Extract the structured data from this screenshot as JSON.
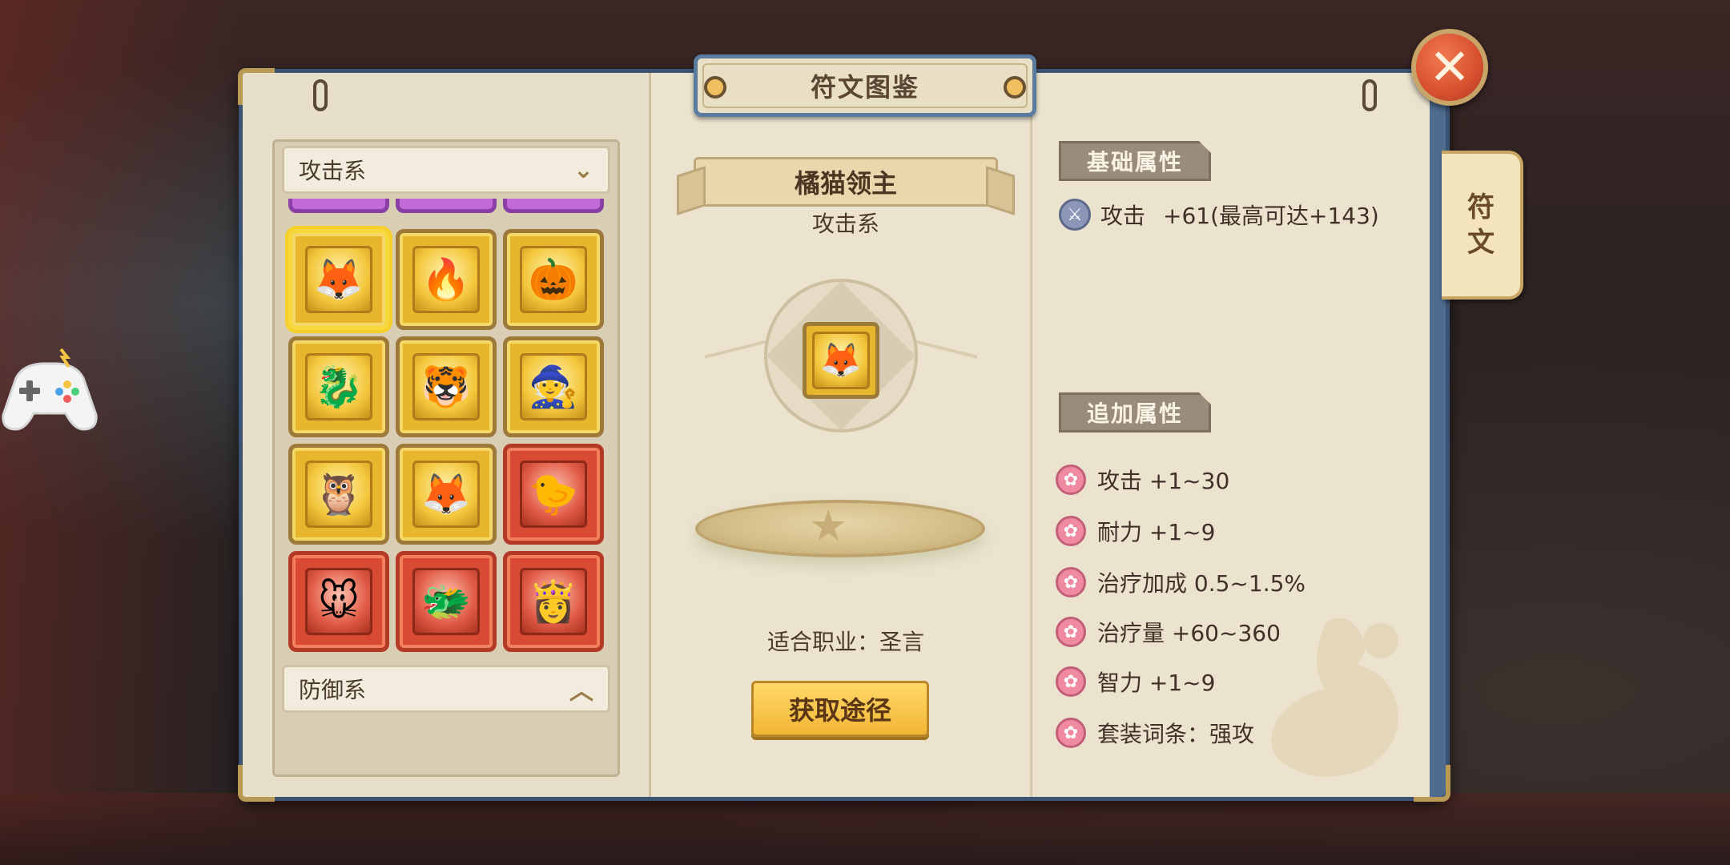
{
  "title": "符文图鉴",
  "close": {
    "icon": "close-icon",
    "glyph": "✕"
  },
  "side_tab": {
    "label_line1": "符",
    "label_line2": "文"
  },
  "left": {
    "top_dropdown": {
      "label": "攻击系",
      "chevron": "⌄"
    },
    "bottom_dropdown": {
      "label": "防御系",
      "chevron": "︿"
    },
    "runes": [
      {
        "name": "橘猫领主",
        "rarity": "gold",
        "glyph": "🦊",
        "selected": true
      },
      {
        "name": "rune-fire-fox",
        "rarity": "gold",
        "glyph": "🔥"
      },
      {
        "name": "rune-pumpkin-witch",
        "rarity": "gold",
        "glyph": "🎃"
      },
      {
        "name": "rune-red-dragon",
        "rarity": "gold",
        "glyph": "🐉"
      },
      {
        "name": "rune-white-tiger",
        "rarity": "gold",
        "glyph": "🐯"
      },
      {
        "name": "rune-hooded-mage",
        "rarity": "gold",
        "glyph": "🧙"
      },
      {
        "name": "rune-owl-goggles",
        "rarity": "gold",
        "glyph": "🦉"
      },
      {
        "name": "rune-ice-fox",
        "rarity": "gold",
        "glyph": "🦊"
      },
      {
        "name": "rune-chick-captain",
        "rarity": "red",
        "glyph": "🐤"
      },
      {
        "name": "rune-grey-mouse-girl",
        "rarity": "red",
        "glyph": "🐭"
      },
      {
        "name": "rune-dark-dragon",
        "rarity": "red",
        "glyph": "🐲"
      },
      {
        "name": "rune-blonde-queen",
        "rarity": "red",
        "glyph": "👸"
      }
    ]
  },
  "detail": {
    "name": "橘猫领主",
    "category": "攻击系",
    "rune_glyph": "🦊",
    "job": "适合职业：圣言",
    "acquire_button": "获取途径"
  },
  "attributes": {
    "base_header": "基础属性",
    "base": [
      {
        "icon": "sword-icon",
        "name": "攻击",
        "value": "+61(最高可达+143)"
      }
    ],
    "extra_header": "追加属性",
    "extra": [
      {
        "icon": "pink-person-icon",
        "text": "攻击 +1~30"
      },
      {
        "icon": "pink-person-icon",
        "text": "耐力 +1~9"
      },
      {
        "icon": "pink-person-icon",
        "text": "治疗加成 0.5~1.5%"
      },
      {
        "icon": "pink-person-icon",
        "text": "治疗量 +60~360"
      },
      {
        "icon": "pink-person-icon",
        "text": "智力 +1~9"
      },
      {
        "icon": "pink-person-icon",
        "text": "套装词条：强攻"
      }
    ]
  },
  "colors": {
    "frame": "#4e6c8e",
    "parchment": "#ece3cf",
    "gold": "#e7b62c",
    "red": "#d84a34",
    "accent_button": "#f2b535"
  }
}
